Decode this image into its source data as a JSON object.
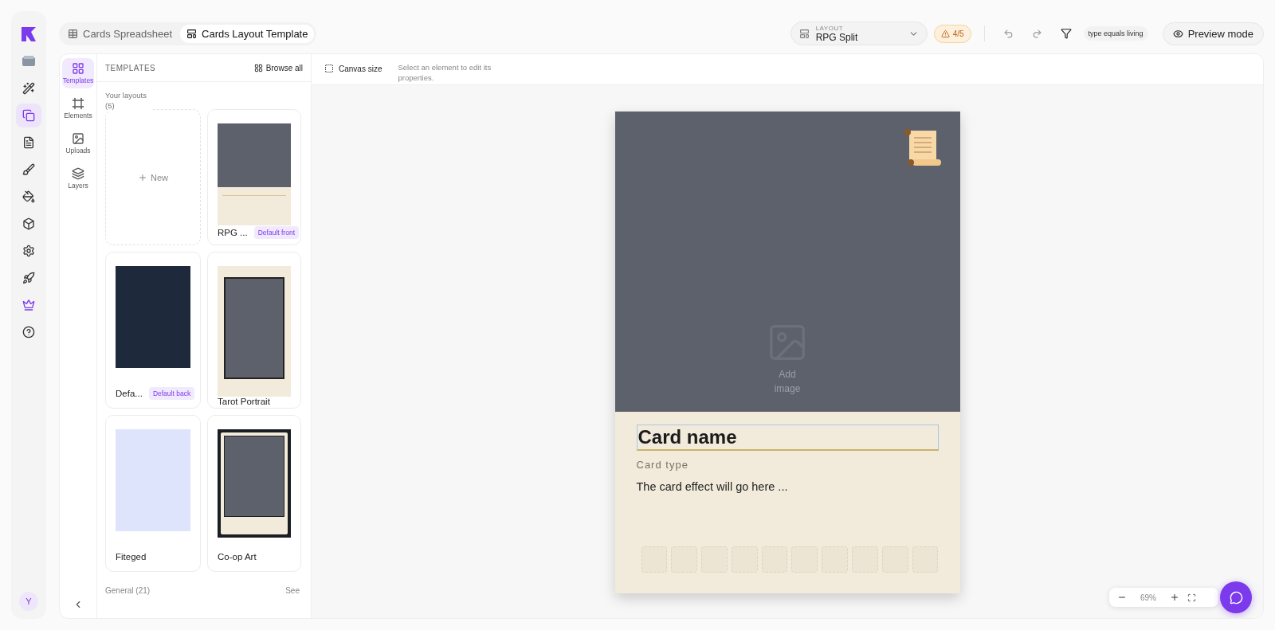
{
  "rail": {
    "items": [
      {
        "selected": false
      },
      {
        "selected": false
      },
      {
        "selected": false
      },
      {
        "selected": true
      },
      {
        "selected": false
      },
      {
        "selected": false
      },
      {
        "selected": false
      },
      {
        "selected": false
      },
      {
        "selected": false
      },
      {
        "selected": false
      },
      {
        "selected": false
      },
      {
        "selected": false
      }
    ],
    "avatar": "Y"
  },
  "tabs": [
    {
      "label": "Cards Spreadsheet",
      "selected": false
    },
    {
      "label": "Cards Layout Template",
      "selected": true
    }
  ],
  "toolbar": {
    "layout_label": "LAYOUT",
    "layout_value": "RPG Split",
    "warning": "4/5",
    "filter_chip": "type equals living",
    "preview_button": "Preview mode"
  },
  "tools": [
    {
      "label": "Templates",
      "selected": true
    },
    {
      "label": "Elements",
      "selected": false
    },
    {
      "label": "Uploads",
      "selected": false
    },
    {
      "label": "Layers",
      "selected": false
    }
  ],
  "templates_panel": {
    "title": "TEMPLATES",
    "browse_all": "Browse all",
    "section": "Your layouts (5)",
    "new_label": "New",
    "items": [
      {
        "name": "RPG ...",
        "badge": "Default front",
        "kind": "rpg"
      },
      {
        "name": "Defa...",
        "badge": "Default back",
        "kind": "navy"
      },
      {
        "name": "Tarot Portrait",
        "kind": "tarot"
      },
      {
        "name": "Fiteged",
        "kind": "plain"
      },
      {
        "name": "Co-op Art",
        "kind": "framed"
      }
    ],
    "general": "General (21)",
    "see": "See"
  },
  "canvas": {
    "canvas_size": "Canvas size",
    "hint": "Select an element to edit its properties.",
    "card": {
      "add_image": "Add image",
      "name": "Card name",
      "type": "Card type",
      "effect": "The card effect will go here ..."
    },
    "zoom": "69%"
  }
}
